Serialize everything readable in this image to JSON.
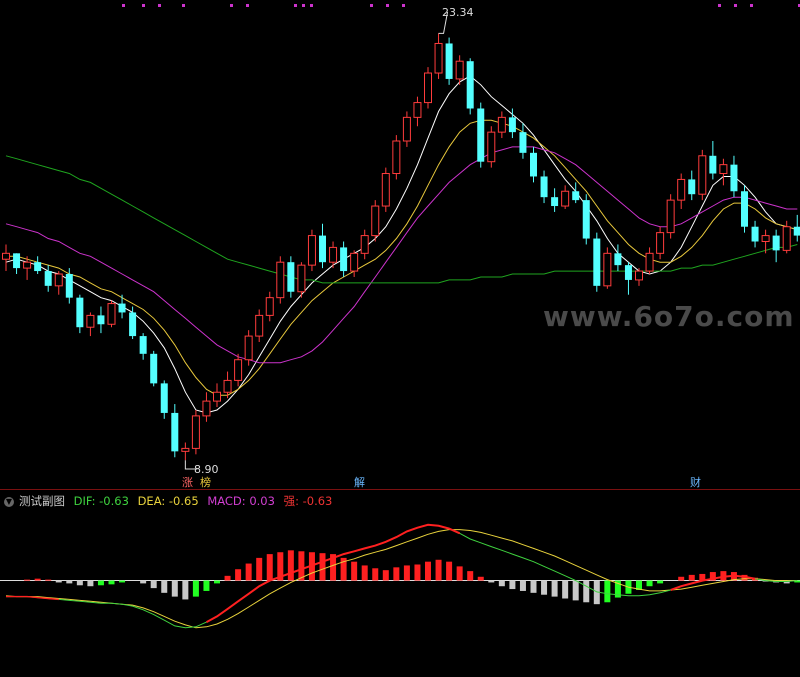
{
  "chart_data": [
    {
      "type": "candlestick",
      "price_axis_range": [
        8.4,
        24.2
      ],
      "annotations": {
        "high_label": "23.34",
        "low_label": "8.90"
      },
      "event_tags": [
        "涨",
        "榜",
        "解",
        "财"
      ],
      "watermark": "www.6o7o.com",
      "candles": [
        [
          15.7,
          16.2,
          15.3,
          15.9
        ],
        [
          15.9,
          15.9,
          15.2,
          15.4
        ],
        [
          15.4,
          15.8,
          15.0,
          15.6
        ],
        [
          15.6,
          15.8,
          15.2,
          15.3
        ],
        [
          15.3,
          15.5,
          14.6,
          14.8
        ],
        [
          14.8,
          15.3,
          14.5,
          15.2
        ],
        [
          15.2,
          15.4,
          14.2,
          14.4
        ],
        [
          14.4,
          14.5,
          13.2,
          13.4
        ],
        [
          13.4,
          13.9,
          13.1,
          13.8
        ],
        [
          13.8,
          14.1,
          13.2,
          13.5
        ],
        [
          13.5,
          14.3,
          13.4,
          14.2
        ],
        [
          14.2,
          14.5,
          13.7,
          13.9
        ],
        [
          13.9,
          14.1,
          13.0,
          13.1
        ],
        [
          13.1,
          13.2,
          12.3,
          12.5
        ],
        [
          12.5,
          12.6,
          11.4,
          11.5
        ],
        [
          11.5,
          11.6,
          10.3,
          10.5
        ],
        [
          10.5,
          10.8,
          9.0,
          9.2
        ],
        [
          9.2,
          9.5,
          8.9,
          9.3
        ],
        [
          9.3,
          10.6,
          9.1,
          10.4
        ],
        [
          10.4,
          11.2,
          10.2,
          10.9
        ],
        [
          10.9,
          11.5,
          10.7,
          11.2
        ],
        [
          11.2,
          11.9,
          11.0,
          11.6
        ],
        [
          11.6,
          12.5,
          11.4,
          12.3
        ],
        [
          12.3,
          13.3,
          12.1,
          13.1
        ],
        [
          13.1,
          14.0,
          12.9,
          13.8
        ],
        [
          13.8,
          14.6,
          13.6,
          14.4
        ],
        [
          14.4,
          15.8,
          14.2,
          15.6
        ],
        [
          15.6,
          15.8,
          14.4,
          14.6
        ],
        [
          14.6,
          15.6,
          14.4,
          15.5
        ],
        [
          15.5,
          16.7,
          15.3,
          16.5
        ],
        [
          16.5,
          16.9,
          15.4,
          15.6
        ],
        [
          15.6,
          16.3,
          15.4,
          16.1
        ],
        [
          16.1,
          16.3,
          15.1,
          15.3
        ],
        [
          15.3,
          16.0,
          15.1,
          15.9
        ],
        [
          15.9,
          16.7,
          15.7,
          16.5
        ],
        [
          16.5,
          17.7,
          16.3,
          17.5
        ],
        [
          17.5,
          18.8,
          17.3,
          18.6
        ],
        [
          18.6,
          19.9,
          18.4,
          19.7
        ],
        [
          19.7,
          20.7,
          19.5,
          20.5
        ],
        [
          20.5,
          21.2,
          20.2,
          21.0
        ],
        [
          21.0,
          22.2,
          20.8,
          22.0
        ],
        [
          22.0,
          23.34,
          21.8,
          23.0
        ],
        [
          23.0,
          23.2,
          21.6,
          21.8
        ],
        [
          21.8,
          22.6,
          21.6,
          22.4
        ],
        [
          22.4,
          22.5,
          20.6,
          20.8
        ],
        [
          20.8,
          21.0,
          18.8,
          19.0
        ],
        [
          19.0,
          20.2,
          18.8,
          20.0
        ],
        [
          20.0,
          20.7,
          19.8,
          20.5
        ],
        [
          20.5,
          20.8,
          19.8,
          20.0
        ],
        [
          20.0,
          20.3,
          19.1,
          19.3
        ],
        [
          19.3,
          19.5,
          18.3,
          18.5
        ],
        [
          18.5,
          18.7,
          17.6,
          17.8
        ],
        [
          17.8,
          18.1,
          17.3,
          17.5
        ],
        [
          17.5,
          18.2,
          17.4,
          18.0
        ],
        [
          18.0,
          18.3,
          17.6,
          17.7
        ],
        [
          17.7,
          17.9,
          16.2,
          16.4
        ],
        [
          16.4,
          16.6,
          14.6,
          14.8
        ],
        [
          14.8,
          16.1,
          14.7,
          15.9
        ],
        [
          15.9,
          16.2,
          15.3,
          15.5
        ],
        [
          15.5,
          15.6,
          14.5,
          15.0
        ],
        [
          15.0,
          15.4,
          14.8,
          15.3
        ],
        [
          15.3,
          16.1,
          15.2,
          15.9
        ],
        [
          15.9,
          16.8,
          15.7,
          16.6
        ],
        [
          16.6,
          17.9,
          16.4,
          17.7
        ],
        [
          17.7,
          18.6,
          17.4,
          18.4
        ],
        [
          18.4,
          18.7,
          17.7,
          17.9
        ],
        [
          17.9,
          19.4,
          17.7,
          19.2
        ],
        [
          19.2,
          19.7,
          18.4,
          18.6
        ],
        [
          18.6,
          19.1,
          18.2,
          18.9
        ],
        [
          18.9,
          19.2,
          17.8,
          18.0
        ],
        [
          18.0,
          18.2,
          16.6,
          16.8
        ],
        [
          16.8,
          17.0,
          16.1,
          16.3
        ],
        [
          16.3,
          16.7,
          15.9,
          16.5
        ],
        [
          16.5,
          16.7,
          15.6,
          16.0
        ],
        [
          16.0,
          17.0,
          15.9,
          16.8
        ],
        [
          16.8,
          17.2,
          16.3,
          16.5
        ]
      ],
      "moving_averages": [
        {
          "color": "#ffffff",
          "values": [
            15.6,
            15.7,
            15.6,
            15.5,
            15.3,
            15.2,
            15.0,
            14.8,
            14.6,
            14.4,
            14.3,
            14.1,
            13.9,
            13.6,
            13.2,
            12.7,
            12.0,
            11.2,
            10.6,
            10.5,
            10.6,
            10.9,
            11.3,
            11.8,
            12.4,
            13.0,
            13.6,
            14.1,
            14.5,
            14.9,
            15.2,
            15.5,
            15.7,
            15.9,
            16.1,
            16.4,
            16.8,
            17.4,
            18.1,
            18.9,
            19.8,
            20.7,
            21.3,
            21.7,
            21.9,
            21.6,
            21.2,
            20.9,
            20.6,
            20.3,
            19.9,
            19.4,
            18.9,
            18.4,
            18.0,
            17.5,
            17.0,
            16.4,
            15.9,
            15.6,
            15.3,
            15.2,
            15.3,
            15.6,
            16.1,
            16.8,
            17.5,
            18.2,
            18.5,
            18.5,
            18.2,
            17.8,
            17.3,
            16.9,
            16.8,
            16.7
          ]
        },
        {
          "color": "#e8c83c",
          "values": [
            15.8,
            15.8,
            15.7,
            15.6,
            15.5,
            15.4,
            15.2,
            15.1,
            14.9,
            14.7,
            14.6,
            14.4,
            14.2,
            14.0,
            13.7,
            13.3,
            12.8,
            12.2,
            11.7,
            11.3,
            11.1,
            11.1,
            11.3,
            11.6,
            12.0,
            12.5,
            13.0,
            13.5,
            13.9,
            14.3,
            14.6,
            14.9,
            15.1,
            15.3,
            15.5,
            15.7,
            16.0,
            16.4,
            16.9,
            17.5,
            18.2,
            18.9,
            19.5,
            20.0,
            20.3,
            20.4,
            20.4,
            20.3,
            20.2,
            20.0,
            19.8,
            19.5,
            19.2,
            18.8,
            18.4,
            18.0,
            17.5,
            17.0,
            16.6,
            16.2,
            15.9,
            15.7,
            15.6,
            15.6,
            15.8,
            16.1,
            16.5,
            17.0,
            17.4,
            17.6,
            17.6,
            17.4,
            17.1,
            16.9,
            16.8,
            16.7
          ]
        },
        {
          "color": "#cc33cc",
          "values": [
            16.9,
            16.8,
            16.7,
            16.6,
            16.4,
            16.3,
            16.1,
            15.9,
            15.8,
            15.6,
            15.4,
            15.2,
            15.0,
            14.8,
            14.6,
            14.3,
            14.0,
            13.7,
            13.4,
            13.1,
            12.8,
            12.6,
            12.4,
            12.3,
            12.2,
            12.2,
            12.2,
            12.3,
            12.4,
            12.6,
            12.9,
            13.3,
            13.7,
            14.1,
            14.6,
            15.1,
            15.6,
            16.1,
            16.6,
            17.1,
            17.5,
            17.9,
            18.3,
            18.6,
            18.9,
            19.1,
            19.3,
            19.4,
            19.5,
            19.5,
            19.5,
            19.4,
            19.3,
            19.1,
            18.9,
            18.6,
            18.3,
            18.0,
            17.7,
            17.4,
            17.1,
            16.9,
            16.8,
            16.8,
            16.9,
            17.1,
            17.3,
            17.5,
            17.7,
            17.8,
            17.8,
            17.7,
            17.6,
            17.5,
            17.4,
            17.4
          ]
        },
        {
          "color": "#1fa51f",
          "values": [
            19.2,
            19.1,
            19.0,
            18.9,
            18.8,
            18.7,
            18.6,
            18.4,
            18.3,
            18.1,
            17.9,
            17.7,
            17.5,
            17.3,
            17.1,
            16.9,
            16.7,
            16.5,
            16.3,
            16.1,
            15.9,
            15.7,
            15.6,
            15.5,
            15.4,
            15.3,
            15.2,
            15.1,
            15.0,
            15.0,
            14.9,
            14.9,
            14.9,
            14.9,
            14.9,
            14.9,
            14.9,
            14.9,
            14.9,
            14.9,
            14.9,
            14.9,
            15.0,
            15.0,
            15.0,
            15.1,
            15.1,
            15.1,
            15.2,
            15.2,
            15.2,
            15.2,
            15.3,
            15.3,
            15.3,
            15.3,
            15.3,
            15.3,
            15.3,
            15.3,
            15.3,
            15.3,
            15.3,
            15.3,
            15.4,
            15.4,
            15.5,
            15.5,
            15.6,
            15.7,
            15.8,
            15.9,
            16.0,
            16.1,
            16.1,
            16.2
          ]
        }
      ]
    },
    {
      "type": "macd",
      "indicator_name": "测试副图",
      "legend": [
        {
          "label": "DIF: -0.63",
          "color": "#3fd23f"
        },
        {
          "label": "DEA: -0.65",
          "color": "#e8d23c"
        },
        {
          "label": "MACD: 0.03",
          "color": "#d23fd2"
        },
        {
          "label": "强: -0.63",
          "color": "#ee3333"
        }
      ],
      "value_range": [
        -1.0,
        0.8
      ],
      "macd_bars": [
        0.0,
        0.0,
        0.01,
        0.02,
        0.01,
        -0.02,
        -0.03,
        -0.05,
        -0.06,
        -0.05,
        -0.04,
        -0.02,
        0.0,
        -0.03,
        -0.08,
        -0.13,
        -0.17,
        -0.2,
        -0.17,
        -0.11,
        -0.03,
        0.05,
        0.12,
        0.18,
        0.24,
        0.28,
        0.3,
        0.32,
        0.31,
        0.3,
        0.29,
        0.28,
        0.24,
        0.2,
        0.16,
        0.13,
        0.11,
        0.14,
        0.16,
        0.17,
        0.2,
        0.22,
        0.2,
        0.15,
        0.1,
        0.04,
        -0.02,
        -0.06,
        -0.09,
        -0.11,
        -0.13,
        -0.15,
        -0.17,
        -0.19,
        -0.21,
        -0.23,
        -0.25,
        -0.23,
        -0.18,
        -0.14,
        -0.1,
        -0.06,
        -0.03,
        0.0,
        0.04,
        0.06,
        0.07,
        0.09,
        0.1,
        0.09,
        0.06,
        0.03,
        -0.01,
        -0.02,
        -0.03,
        -0.02
      ],
      "dif": [
        -0.17,
        -0.17,
        -0.17,
        -0.18,
        -0.19,
        -0.2,
        -0.21,
        -0.22,
        -0.23,
        -0.24,
        -0.24,
        -0.25,
        -0.27,
        -0.31,
        -0.36,
        -0.42,
        -0.48,
        -0.5,
        -0.49,
        -0.44,
        -0.38,
        -0.3,
        -0.22,
        -0.14,
        -0.06,
        0.0,
        0.04,
        0.08,
        0.12,
        0.16,
        0.2,
        0.24,
        0.28,
        0.31,
        0.34,
        0.37,
        0.41,
        0.46,
        0.52,
        0.56,
        0.59,
        0.58,
        0.55,
        0.5,
        0.44,
        0.4,
        0.36,
        0.32,
        0.28,
        0.24,
        0.2,
        0.15,
        0.1,
        0.05,
        0.0,
        -0.06,
        -0.12,
        -0.14,
        -0.15,
        -0.16,
        -0.16,
        -0.15,
        -0.13,
        -0.1,
        -0.06,
        -0.03,
        0.0,
        0.02,
        0.04,
        0.05,
        0.04,
        0.02,
        0.0,
        -0.01,
        -0.01,
        0.0
      ],
      "dea": [
        -0.16,
        -0.17,
        -0.17,
        -0.17,
        -0.18,
        -0.19,
        -0.2,
        -0.21,
        -0.22,
        -0.23,
        -0.24,
        -0.25,
        -0.26,
        -0.29,
        -0.33,
        -0.38,
        -0.43,
        -0.47,
        -0.5,
        -0.49,
        -0.46,
        -0.41,
        -0.35,
        -0.28,
        -0.21,
        -0.14,
        -0.08,
        -0.02,
        0.03,
        0.08,
        0.12,
        0.16,
        0.2,
        0.23,
        0.27,
        0.3,
        0.33,
        0.37,
        0.41,
        0.45,
        0.49,
        0.52,
        0.54,
        0.54,
        0.53,
        0.51,
        0.48,
        0.45,
        0.42,
        0.38,
        0.34,
        0.3,
        0.26,
        0.21,
        0.16,
        0.11,
        0.06,
        0.01,
        -0.03,
        -0.07,
        -0.09,
        -0.11,
        -0.11,
        -0.1,
        -0.09,
        -0.07,
        -0.05,
        -0.03,
        -0.01,
        0.01,
        0.02,
        0.02,
        0.01,
        0.0,
        0.0,
        0.0
      ],
      "strong_active_start": 19,
      "strong_active_end": 43
    }
  ]
}
